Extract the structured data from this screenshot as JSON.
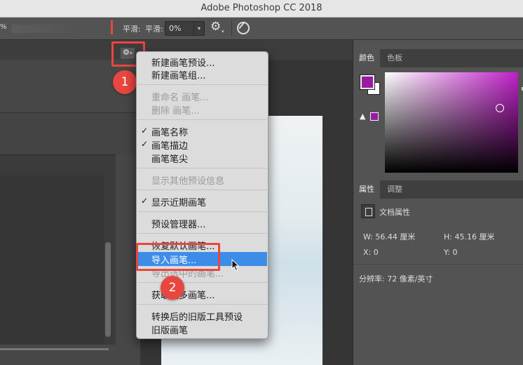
{
  "app": {
    "title": "Adobe Photoshop CC 2018",
    "zoom_fragment": "%"
  },
  "options_bar": {
    "smoothing_label_1": "平滑:",
    "smoothing_label_2": "平滑:",
    "smoothing_value": "0%"
  },
  "brush_menu": {
    "items": [
      {
        "label": "新建画笔预设...",
        "enabled": true
      },
      {
        "label": "新建画笔组...",
        "enabled": true
      },
      {
        "label": "重命名 画笔...",
        "enabled": false
      },
      {
        "label": "删除 画笔...",
        "enabled": false
      },
      {
        "label": "画笔名称",
        "checked": true
      },
      {
        "label": "画笔描边",
        "checked": true
      },
      {
        "label": "画笔笔尖",
        "checked": false
      },
      {
        "label": "显示其他预设信息",
        "enabled": false
      },
      {
        "label": "显示近期画笔",
        "checked": true
      },
      {
        "label": "预设管理器...",
        "enabled": true
      },
      {
        "label": "恢复默认画笔...",
        "enabled": true
      },
      {
        "label": "导入画笔...",
        "highlighted": true
      },
      {
        "label": "导出选中的画笔...",
        "enabled": false
      },
      {
        "label": "获取更多画笔...",
        "enabled": true
      },
      {
        "label": "转换后的旧版工具预设",
        "enabled": true
      },
      {
        "label": "旧版画笔",
        "enabled": true
      }
    ]
  },
  "annotations": {
    "step1": "1",
    "step2": "2",
    "accent_color": "#e8473f"
  },
  "color_panel": {
    "tab_color": "颜色",
    "tab_swatches": "色板",
    "foreground_color": "#9b1aa3",
    "background_color": "#ffffff",
    "picker_hue": "#c020c8"
  },
  "properties_panel": {
    "tab_properties": "属性",
    "tab_adjustments": "调整",
    "doc_title": "文档属性",
    "width": "W: 56.44 厘米",
    "height": "H: 45.16 厘米",
    "x": "X: 0",
    "y": "Y: 0",
    "resolution": "分辨率: 72 像素/英寸"
  },
  "icons": [
    "gear-icon",
    "dropdown-arrow-icon",
    "brush-settings-icon",
    "pressure-icon",
    "warning-icon",
    "document-icon",
    "mouse-cursor-icon"
  ]
}
